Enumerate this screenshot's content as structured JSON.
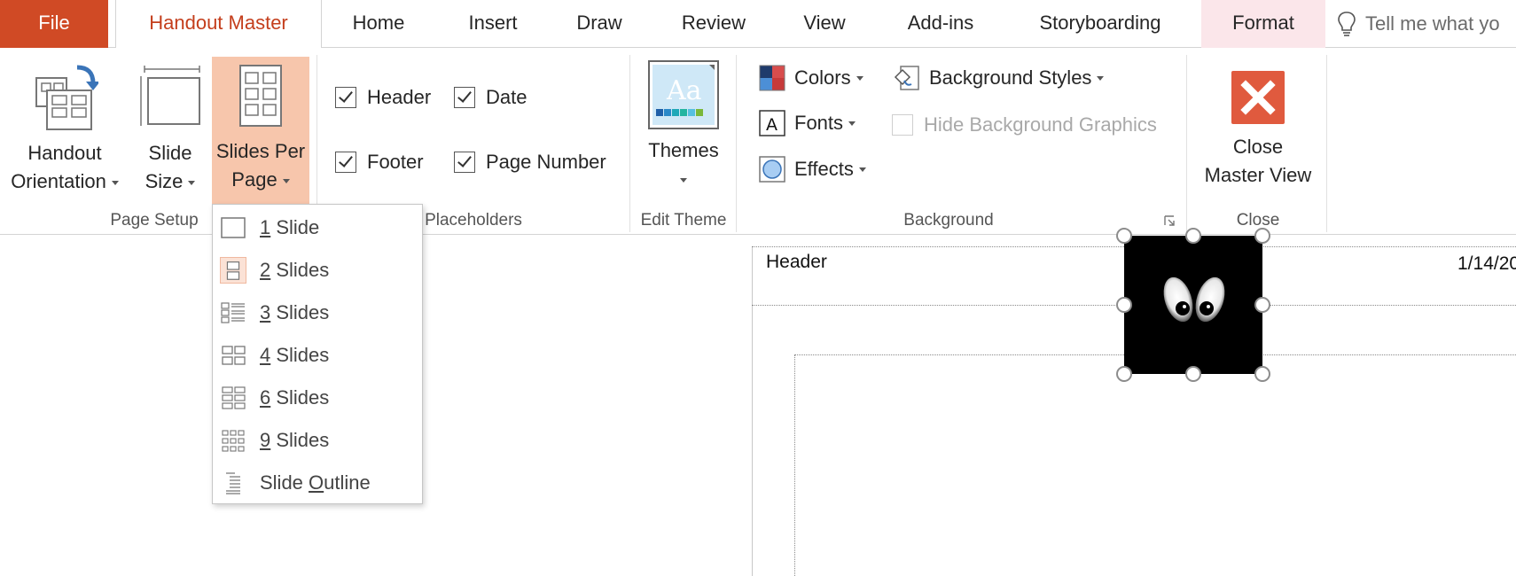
{
  "tabs": {
    "file": "File",
    "handout_master": "Handout Master",
    "home": "Home",
    "insert": "Insert",
    "draw": "Draw",
    "review": "Review",
    "view": "View",
    "addins": "Add-ins",
    "storyboarding": "Storyboarding",
    "format": "Format",
    "tell_me": "Tell me what yo"
  },
  "page_setup": {
    "handout_orientation": [
      "Handout",
      "Orientation"
    ],
    "slide_size": [
      "Slide",
      "Size"
    ],
    "slides_per_page": [
      "Slides Per",
      "Page"
    ],
    "group_label": "Page Setup"
  },
  "placeholders": {
    "header": "Header",
    "date": "Date",
    "footer": "Footer",
    "page_number": "Page Number",
    "group_label": "Placeholders"
  },
  "edit_theme": {
    "themes": "Themes",
    "group_label": "Edit Theme"
  },
  "background": {
    "colors": "Colors",
    "fonts": "Fonts",
    "effects": "Effects",
    "background_styles": "Background Styles",
    "hide_background_graphics": "Hide Background Graphics",
    "group_label": "Background"
  },
  "close": {
    "close_master_view": [
      "Close",
      "Master View"
    ],
    "group_label": "Close"
  },
  "slides_per_page_menu": {
    "items": [
      {
        "key": "1",
        "rest": " Slide"
      },
      {
        "key": "2",
        "rest": " Slides"
      },
      {
        "key": "3",
        "rest": " Slides"
      },
      {
        "key": "4",
        "rest": " Slides"
      },
      {
        "key": "6",
        "rest": " Slides"
      },
      {
        "key": "9",
        "rest": " Slides"
      },
      {
        "pre": "Slide ",
        "key": "O",
        "rest": "utline"
      }
    ],
    "selected_index": 1
  },
  "canvas": {
    "header_text": "Header",
    "date_text": "1/14/20"
  },
  "colors": {
    "file_tab": "#d04a25",
    "active_tab_text": "#c43e1c",
    "pressed_button": "#f7c6ac",
    "close_button": "#e05a3e"
  }
}
